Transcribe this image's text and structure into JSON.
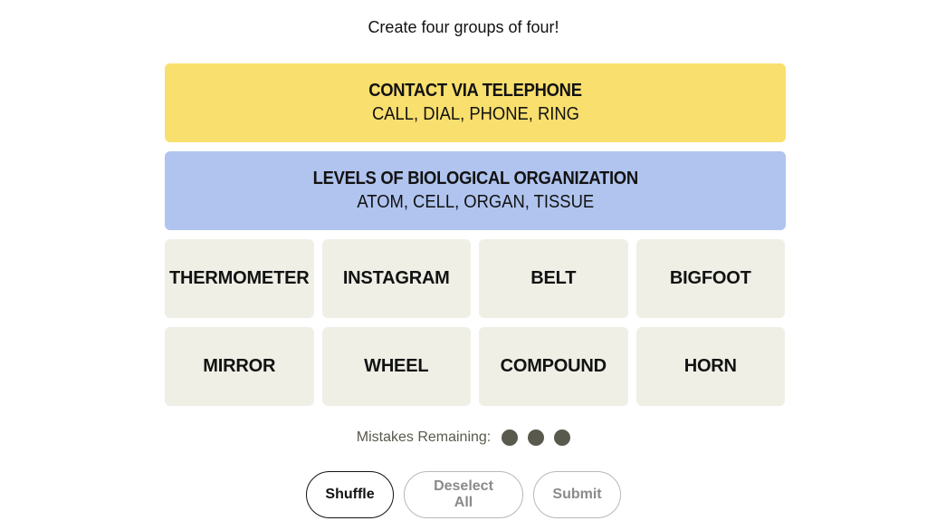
{
  "subtitle": "Create four groups of four!",
  "solved_groups": [
    {
      "category": "CONTACT VIA TELEPHONE",
      "words": "CALL, DIAL, PHONE, RING",
      "color": "#f9df6d"
    },
    {
      "category": "LEVELS OF BIOLOGICAL ORGANIZATION",
      "words": "ATOM, CELL, ORGAN, TISSUE",
      "color": "#b0c4ef"
    }
  ],
  "tiles": [
    "THERMOMETER",
    "INSTAGRAM",
    "BELT",
    "BIGFOOT",
    "MIRROR",
    "WHEEL",
    "COMPOUND",
    "HORN"
  ],
  "mistakes": {
    "label": "Mistakes Remaining:",
    "remaining": 3
  },
  "buttons": {
    "shuffle": "Shuffle",
    "deselect_all": "Deselect All",
    "submit": "Submit"
  }
}
